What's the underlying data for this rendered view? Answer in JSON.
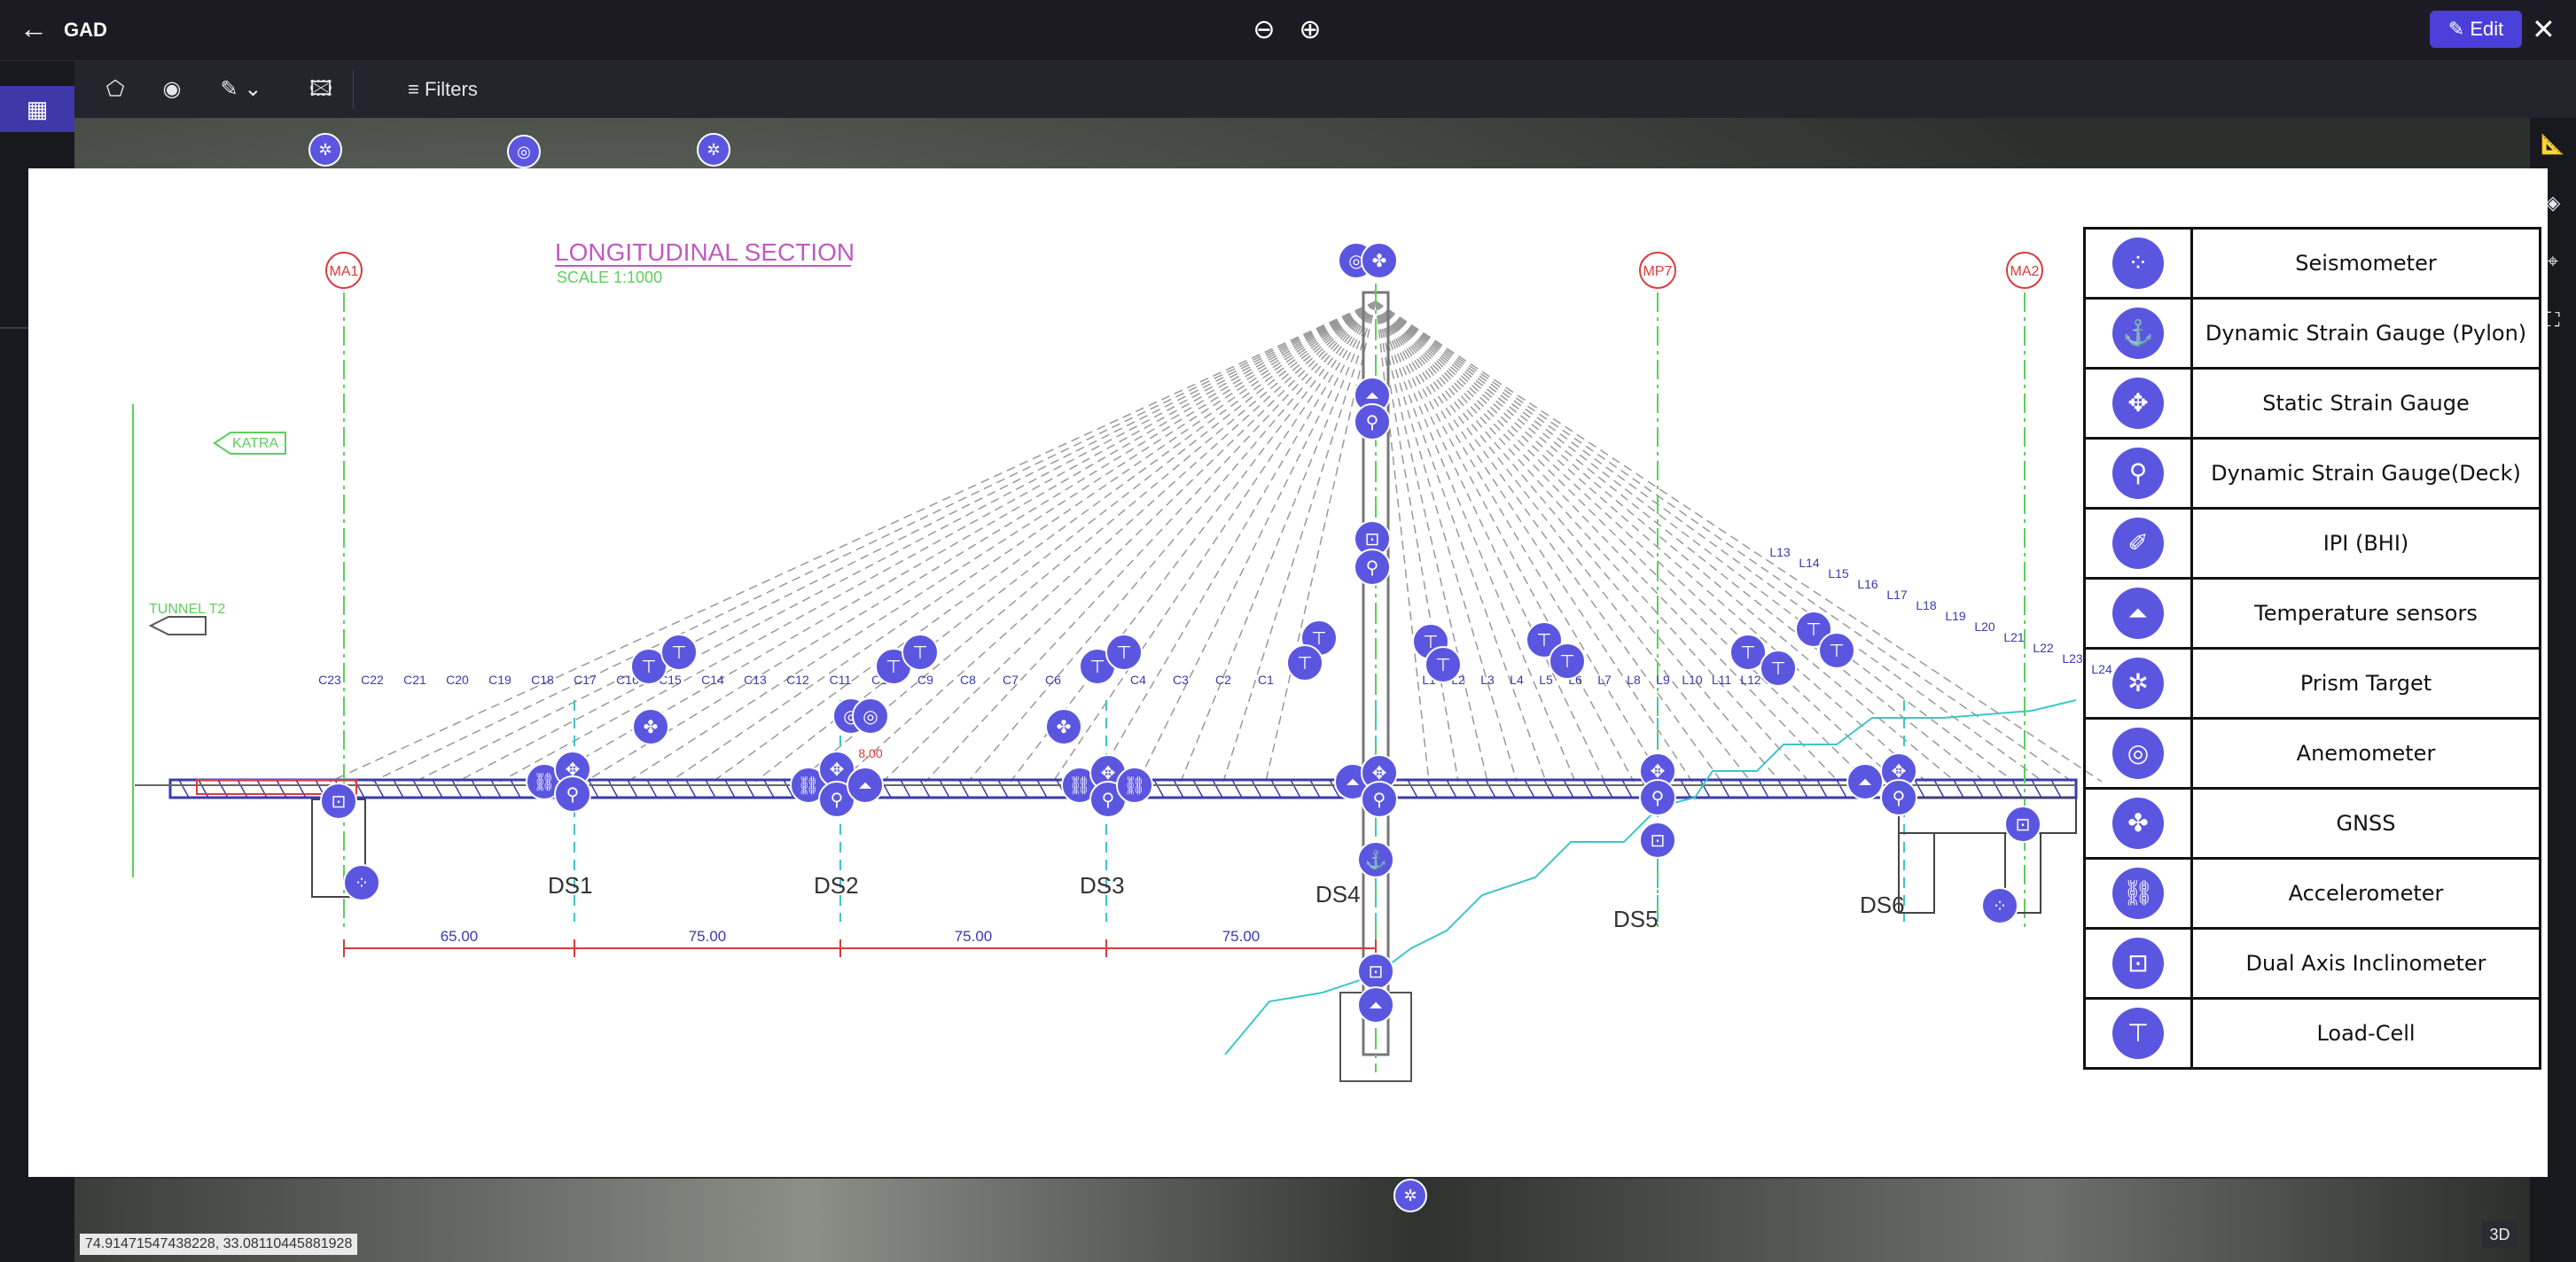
{
  "app": {
    "back_icon": "arrow-left-icon",
    "title": "GAD",
    "edit_label": "Edit",
    "edit_icon": "pencil-icon",
    "close_icon": "close-icon",
    "zoom_out_icon": "zoom-out-icon",
    "zoom_in_icon": "zoom-in-icon"
  },
  "toolbar": {
    "filters_label": "Filters",
    "tools": [
      "polygon-icon",
      "pointer-icon",
      "pen-icon",
      "image-icon"
    ]
  },
  "sidebar": {
    "items": [
      "map-icon",
      "database-icon",
      "chart-icon",
      "file-icon"
    ]
  },
  "right_rail": {
    "items": [
      "ruler-icon",
      "layers-icon",
      "pin-icon",
      "scan-icon"
    ]
  },
  "map": {
    "coords": "74.91471547438228, 33.08110445881928",
    "mode_label": "3D"
  },
  "drawing": {
    "title": "LONGITUDINAL SECTION",
    "scale": "SCALE 1:1000",
    "katra": "KATRA",
    "tunnel": "TUNNEL T2",
    "axes": [
      "MA1",
      "MP7",
      "MA2"
    ],
    "piers": [
      "DS1",
      "DS2",
      "DS3",
      "DS4",
      "DS5",
      "DS6"
    ],
    "spans": [
      "65.00",
      "75.00",
      "75.00",
      "75.00"
    ],
    "cables_left": [
      "C23",
      "C22",
      "C21",
      "C20",
      "C19",
      "C18",
      "C17",
      "C16",
      "C15",
      "C14",
      "C13",
      "C12",
      "C11",
      "C10",
      "C9",
      "C8",
      "C7",
      "C6",
      "C5",
      "C4",
      "C3",
      "C2",
      "C1"
    ],
    "cables_right": [
      "L1",
      "L2",
      "L3",
      "L4",
      "L5",
      "L6",
      "L7",
      "L8",
      "L9",
      "L10",
      "L11",
      "L12",
      "L13",
      "L14",
      "L15",
      "L16",
      "L17",
      "L18",
      "L19",
      "L20",
      "L21",
      "L22",
      "L23",
      "L24"
    ],
    "dim_label": "8.00"
  },
  "legend": [
    {
      "label": "Seismometer",
      "icon": "seismometer-icon"
    },
    {
      "label": "Dynamic Strain Gauge (Pylon)",
      "icon": "strain-gauge-pylon-icon"
    },
    {
      "label": "Static Strain Gauge",
      "icon": "static-strain-gauge-icon"
    },
    {
      "label": "Dynamic Strain Gauge(Deck)",
      "icon": "strain-gauge-deck-icon"
    },
    {
      "label": "IPI (BHI)",
      "icon": "ipi-icon"
    },
    {
      "label": "Temperature sensors",
      "icon": "temperature-icon"
    },
    {
      "label": "Prism Target",
      "icon": "prism-target-icon"
    },
    {
      "label": "Anemometer",
      "icon": "anemometer-icon"
    },
    {
      "label": "GNSS",
      "icon": "gnss-icon"
    },
    {
      "label": "Accelerometer",
      "icon": "accelerometer-icon"
    },
    {
      "label": "Dual Axis Inclinometer",
      "icon": "inclinometer-icon"
    },
    {
      "label": "Load-Cell",
      "icon": "load-cell-icon"
    }
  ],
  "colors": {
    "accent": "#4a3fd8",
    "marker": "#5b56e0",
    "cad_green": "#5ccf5c",
    "cad_red": "#d93b3b",
    "cad_blue": "#3a3ab0",
    "cad_cyan": "#3ec6c6",
    "cad_magenta": "#c05ac0"
  }
}
